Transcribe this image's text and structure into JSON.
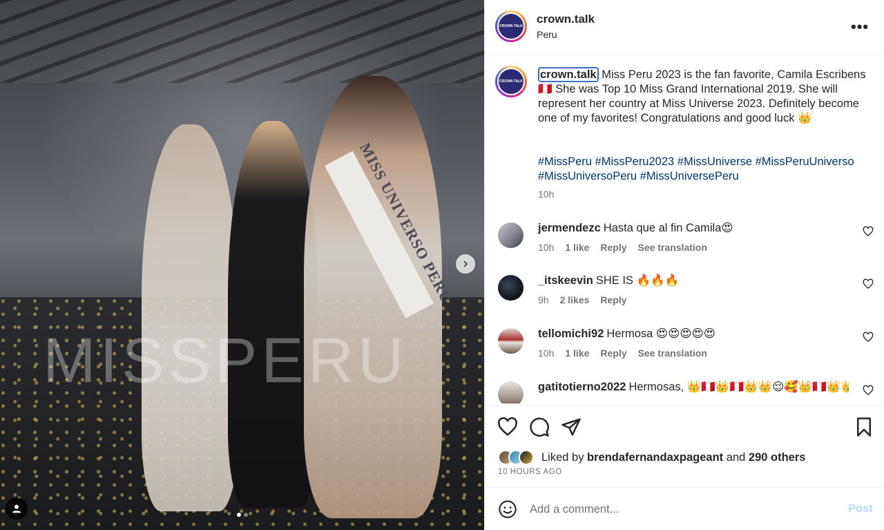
{
  "post": {
    "username": "crown.talk",
    "location": "Peru",
    "more_label": "•••",
    "avatar_text": "CROWN TALK",
    "photo_watermark": "MISSPERU",
    "sash_text": "MISS UNIVERSO PERÚ",
    "caption_user": "crown.talk",
    "caption_text": " Miss Peru 2023 is the fan favorite, Camila Escribens 🇵🇪 She was Top 10 Miss Grand International 2019. She will represent her country at Miss Universe 2023. Definitely become one of my favorites! Congratulations and good luck 👑",
    "hashtags": [
      "#MissPeru",
      "#MissPeru2023",
      "#MissUniverse",
      "#MissPeruUniverso",
      "#MissUniversoPeru",
      "#MissUniversePeru"
    ],
    "caption_time": "10h"
  },
  "comments": [
    {
      "user": "jermendezc",
      "text": "Hasta que al fin Camila😍",
      "time": "10h",
      "likes": "1 like",
      "reply": "Reply",
      "translate": "See translation"
    },
    {
      "user": "_itskeevin",
      "text": "SHE IS 🔥🔥🔥",
      "time": "9h",
      "likes": "2 likes",
      "reply": "Reply",
      "translate": ""
    },
    {
      "user": "tellomichi92",
      "text": "Hermosa 😍😍😍😍😍",
      "time": "10h",
      "likes": "1 like",
      "reply": "Reply",
      "translate": "See translation"
    },
    {
      "user": "gatitotierno2022",
      "text": "Hermosas, 👑🇵🇪👑🇵🇪👑👑😌🥰👑🇵🇪👑👑🇵🇪",
      "time": "",
      "likes": "",
      "reply": "",
      "translate": ""
    }
  ],
  "likes": {
    "prefix": "Liked by ",
    "user": "brendafernandaxpageant",
    "connector": " and ",
    "others": "290 others"
  },
  "post_time": "10 HOURS AGO",
  "composer": {
    "placeholder": "Add a comment...",
    "post_label": "Post"
  },
  "colors": {
    "link": "#00376b",
    "post_disabled": "#b3dbff",
    "meta": "#737373"
  }
}
